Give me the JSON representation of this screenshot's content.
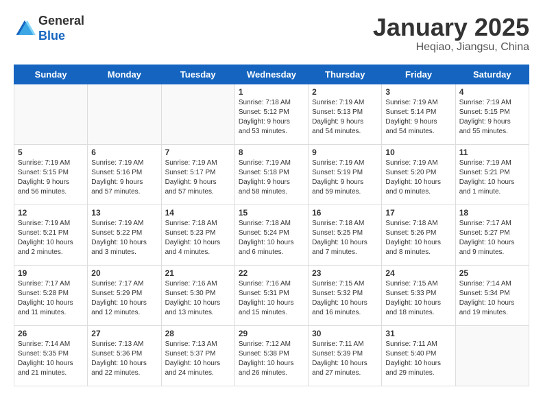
{
  "header": {
    "logo_general": "General",
    "logo_blue": "Blue",
    "month_title": "January 2025",
    "location": "Heqiao, Jiangsu, China"
  },
  "weekdays": [
    "Sunday",
    "Monday",
    "Tuesday",
    "Wednesday",
    "Thursday",
    "Friday",
    "Saturday"
  ],
  "weeks": [
    [
      {
        "day": "",
        "info": ""
      },
      {
        "day": "",
        "info": ""
      },
      {
        "day": "",
        "info": ""
      },
      {
        "day": "1",
        "info": "Sunrise: 7:18 AM\nSunset: 5:12 PM\nDaylight: 9 hours\nand 53 minutes."
      },
      {
        "day": "2",
        "info": "Sunrise: 7:19 AM\nSunset: 5:13 PM\nDaylight: 9 hours\nand 54 minutes."
      },
      {
        "day": "3",
        "info": "Sunrise: 7:19 AM\nSunset: 5:14 PM\nDaylight: 9 hours\nand 54 minutes."
      },
      {
        "day": "4",
        "info": "Sunrise: 7:19 AM\nSunset: 5:15 PM\nDaylight: 9 hours\nand 55 minutes."
      }
    ],
    [
      {
        "day": "5",
        "info": "Sunrise: 7:19 AM\nSunset: 5:15 PM\nDaylight: 9 hours\nand 56 minutes."
      },
      {
        "day": "6",
        "info": "Sunrise: 7:19 AM\nSunset: 5:16 PM\nDaylight: 9 hours\nand 57 minutes."
      },
      {
        "day": "7",
        "info": "Sunrise: 7:19 AM\nSunset: 5:17 PM\nDaylight: 9 hours\nand 57 minutes."
      },
      {
        "day": "8",
        "info": "Sunrise: 7:19 AM\nSunset: 5:18 PM\nDaylight: 9 hours\nand 58 minutes."
      },
      {
        "day": "9",
        "info": "Sunrise: 7:19 AM\nSunset: 5:19 PM\nDaylight: 9 hours\nand 59 minutes."
      },
      {
        "day": "10",
        "info": "Sunrise: 7:19 AM\nSunset: 5:20 PM\nDaylight: 10 hours\nand 0 minutes."
      },
      {
        "day": "11",
        "info": "Sunrise: 7:19 AM\nSunset: 5:21 PM\nDaylight: 10 hours\nand 1 minute."
      }
    ],
    [
      {
        "day": "12",
        "info": "Sunrise: 7:19 AM\nSunset: 5:21 PM\nDaylight: 10 hours\nand 2 minutes."
      },
      {
        "day": "13",
        "info": "Sunrise: 7:19 AM\nSunset: 5:22 PM\nDaylight: 10 hours\nand 3 minutes."
      },
      {
        "day": "14",
        "info": "Sunrise: 7:18 AM\nSunset: 5:23 PM\nDaylight: 10 hours\nand 4 minutes."
      },
      {
        "day": "15",
        "info": "Sunrise: 7:18 AM\nSunset: 5:24 PM\nDaylight: 10 hours\nand 6 minutes."
      },
      {
        "day": "16",
        "info": "Sunrise: 7:18 AM\nSunset: 5:25 PM\nDaylight: 10 hours\nand 7 minutes."
      },
      {
        "day": "17",
        "info": "Sunrise: 7:18 AM\nSunset: 5:26 PM\nDaylight: 10 hours\nand 8 minutes."
      },
      {
        "day": "18",
        "info": "Sunrise: 7:17 AM\nSunset: 5:27 PM\nDaylight: 10 hours\nand 9 minutes."
      }
    ],
    [
      {
        "day": "19",
        "info": "Sunrise: 7:17 AM\nSunset: 5:28 PM\nDaylight: 10 hours\nand 11 minutes."
      },
      {
        "day": "20",
        "info": "Sunrise: 7:17 AM\nSunset: 5:29 PM\nDaylight: 10 hours\nand 12 minutes."
      },
      {
        "day": "21",
        "info": "Sunrise: 7:16 AM\nSunset: 5:30 PM\nDaylight: 10 hours\nand 13 minutes."
      },
      {
        "day": "22",
        "info": "Sunrise: 7:16 AM\nSunset: 5:31 PM\nDaylight: 10 hours\nand 15 minutes."
      },
      {
        "day": "23",
        "info": "Sunrise: 7:15 AM\nSunset: 5:32 PM\nDaylight: 10 hours\nand 16 minutes."
      },
      {
        "day": "24",
        "info": "Sunrise: 7:15 AM\nSunset: 5:33 PM\nDaylight: 10 hours\nand 18 minutes."
      },
      {
        "day": "25",
        "info": "Sunrise: 7:14 AM\nSunset: 5:34 PM\nDaylight: 10 hours\nand 19 minutes."
      }
    ],
    [
      {
        "day": "26",
        "info": "Sunrise: 7:14 AM\nSunset: 5:35 PM\nDaylight: 10 hours\nand 21 minutes."
      },
      {
        "day": "27",
        "info": "Sunrise: 7:13 AM\nSunset: 5:36 PM\nDaylight: 10 hours\nand 22 minutes."
      },
      {
        "day": "28",
        "info": "Sunrise: 7:13 AM\nSunset: 5:37 PM\nDaylight: 10 hours\nand 24 minutes."
      },
      {
        "day": "29",
        "info": "Sunrise: 7:12 AM\nSunset: 5:38 PM\nDaylight: 10 hours\nand 26 minutes."
      },
      {
        "day": "30",
        "info": "Sunrise: 7:11 AM\nSunset: 5:39 PM\nDaylight: 10 hours\nand 27 minutes."
      },
      {
        "day": "31",
        "info": "Sunrise: 7:11 AM\nSunset: 5:40 PM\nDaylight: 10 hours\nand 29 minutes."
      },
      {
        "day": "",
        "info": ""
      }
    ]
  ]
}
